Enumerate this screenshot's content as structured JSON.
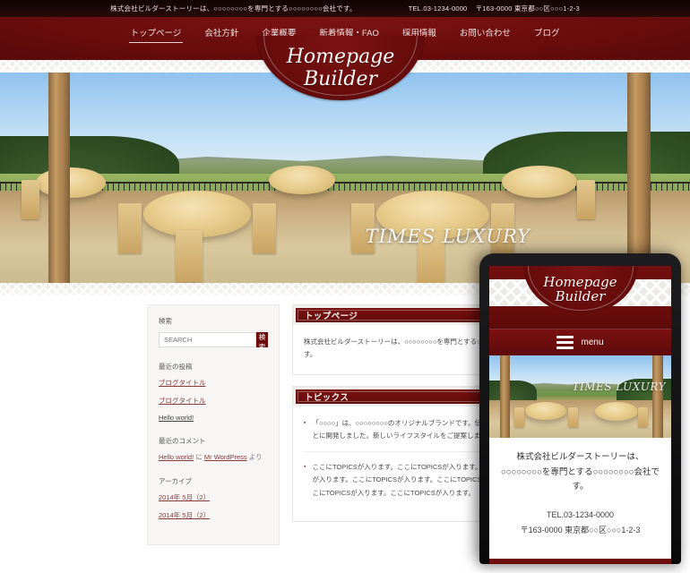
{
  "topbar": {
    "company_line": "株式会社ビルダーストーリーは、○○○○○○○○を専門とする○○○○○○○○会社です。",
    "tel": "TEL.03-1234-0000",
    "address": "〒163-0000 東京都○○区○○○1-2-3"
  },
  "nav": {
    "items": [
      {
        "label": "トップページ",
        "active": true
      },
      {
        "label": "会社方針",
        "active": false
      },
      {
        "label": "企業概要",
        "active": false
      },
      {
        "label": "新着情報・FAQ",
        "active": false
      },
      {
        "label": "採用情報",
        "active": false
      },
      {
        "label": "お問い合わせ",
        "active": false
      },
      {
        "label": "ブログ",
        "active": false
      }
    ]
  },
  "logo": {
    "line1": "Homepage",
    "line2": "Builder"
  },
  "hero": {
    "caption": "TIMES LUXURY"
  },
  "sidebar": {
    "search_heading": "検索",
    "search_value": "",
    "search_placeholder": "SEARCH",
    "search_button": "検索",
    "recent_posts_heading": "最近の投稿",
    "recent_posts": [
      "ブログタイトル",
      "ブログタイトル",
      "Hello world!"
    ],
    "recent_comments_heading": "最近のコメント",
    "recent_comment": {
      "post": "Hello world!",
      "middle": "に",
      "author": "Mr WordPress",
      "suffix": "より"
    },
    "archive_heading": "アーカイブ",
    "archives": [
      "2014年 5月（2）",
      "2014年 5月（2）"
    ]
  },
  "main": {
    "toppage": {
      "title": "トップページ",
      "body": "株式会社ビルダーストーリーは、○○○○○○○○を専門とする○○○○○○○○会社です。"
    },
    "topics": {
      "title": "トピックス",
      "items": [
        "「○○○○」は、○○○○○○○○のオリジナルブランドです。伝統的な技術をもとに開発しました。新しいライフスタイルをご提案します。",
        "ここにTOPICSが入ります。ここにTOPICSが入ります。ここにTOPICSが入ります。ここにTOPICSが入ります。ここにTOPICSが入ります。ここにTOPICSが入ります。ここにTOPICSが入ります。"
      ],
      "bullet": "▪"
    }
  },
  "mobile": {
    "logo": {
      "line1": "Homepage",
      "line2": "Builder"
    },
    "menu_label": "menu",
    "hero_caption": "TIMES LUXURY",
    "lead": "株式会社ビルダーストーリーは、○○○○○○○○を専門とする○○○○○○○○会社です。",
    "tel": "TEL.03-1234-0000",
    "address": "〒163-0000 東京都○○区○○○1-2-3"
  },
  "colors": {
    "maroon": "#6b0d0d",
    "dark_bar": "#1a0707",
    "link": "#8b3a3a",
    "panel_bg": "#f7f6f5"
  }
}
